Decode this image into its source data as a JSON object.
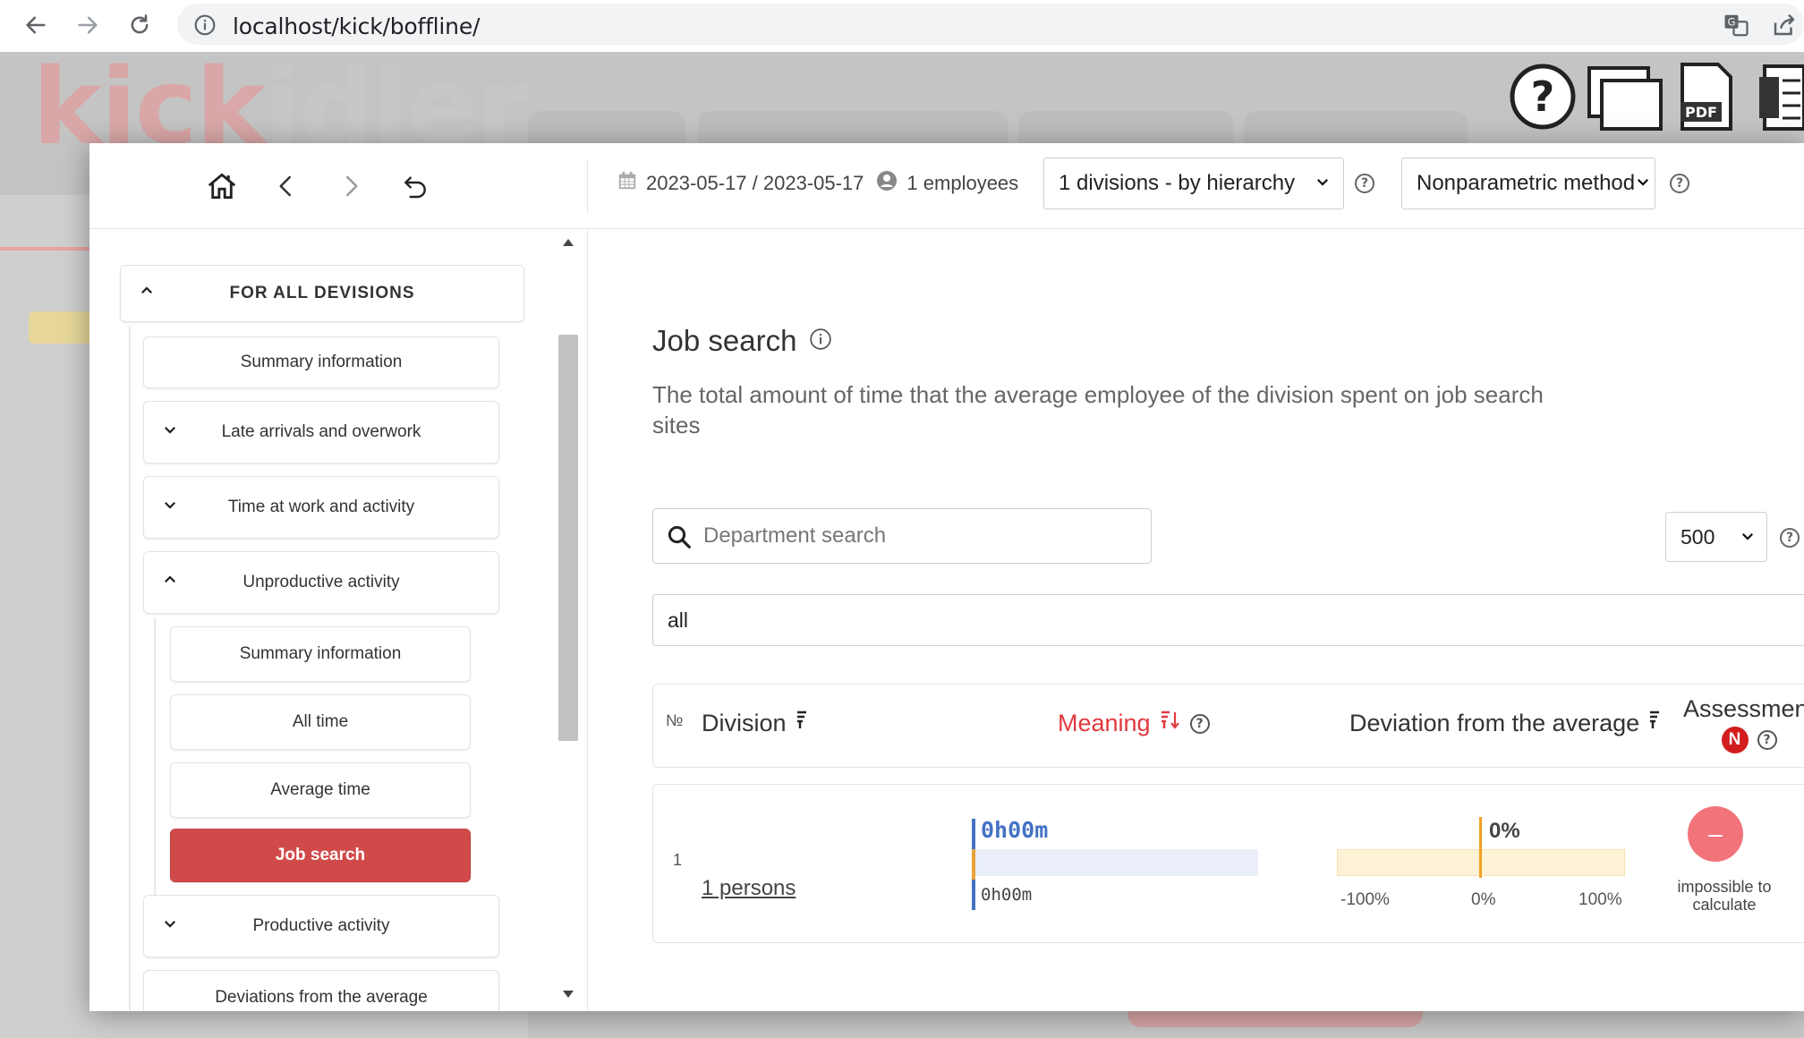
{
  "browser": {
    "url": "localhost/kick/boffline/"
  },
  "background": {
    "logo_part1": "kick",
    "logo_part2": "idler"
  },
  "toolbar_icons": [
    "help-icon",
    "windows-icon",
    "pdf-icon",
    "excel-icon"
  ],
  "toolbar": {
    "pdf_label": "PDF"
  },
  "header": {
    "date_range": "2023-05-17 / 2023-05-17",
    "employees": "1 employees",
    "division_select": "1 divisions - by hierarchy",
    "method_select": "Nonparametric method"
  },
  "sidebar": {
    "section_title": "FOR ALL DEVISIONS",
    "items": [
      {
        "label": "Summary information",
        "chevron": "none"
      },
      {
        "label": "Late arrivals and overwork",
        "chevron": "down"
      },
      {
        "label": "Time at work and activity",
        "chevron": "down"
      },
      {
        "label": "Unproductive activity",
        "chevron": "up"
      }
    ],
    "sub_items": [
      {
        "label": "Summary information"
      },
      {
        "label": "All time"
      },
      {
        "label": "Average time"
      },
      {
        "label": "Job search",
        "active": true
      }
    ],
    "items_after": [
      {
        "label": "Productive activity",
        "chevron": "down"
      },
      {
        "label": "Deviations from the average",
        "chevron": "none"
      }
    ]
  },
  "main": {
    "title": "Job search",
    "description": "The total amount of time that the average employee of the division spent on job search sites",
    "search_placeholder": "Department search",
    "rows_per_page": "500",
    "filter_value": "all",
    "table": {
      "col_no": "№",
      "col_division": "Division",
      "col_meaning": "Meaning",
      "col_deviation": "Deviation from the average",
      "col_assessment": "Assessment",
      "assessment_badge": "N",
      "rows": [
        {
          "no": "1",
          "division": "1 persons",
          "meaning_value": "0h00m",
          "meaning_sub": "0h00m",
          "deviation_value": "0%",
          "deviation_ticks": [
            "-100%",
            "0%",
            "100%"
          ],
          "assessment_symbol": "–",
          "assessment_text_line1": "impossible to",
          "assessment_text_line2": "calculate"
        }
      ]
    }
  },
  "colors": {
    "accent_red": "#d14a4a",
    "meaning_red": "#e0393e",
    "bar_blue": "#4472c4",
    "deviation_orange": "#f0a020",
    "assessment_pink": "#f2737a"
  }
}
